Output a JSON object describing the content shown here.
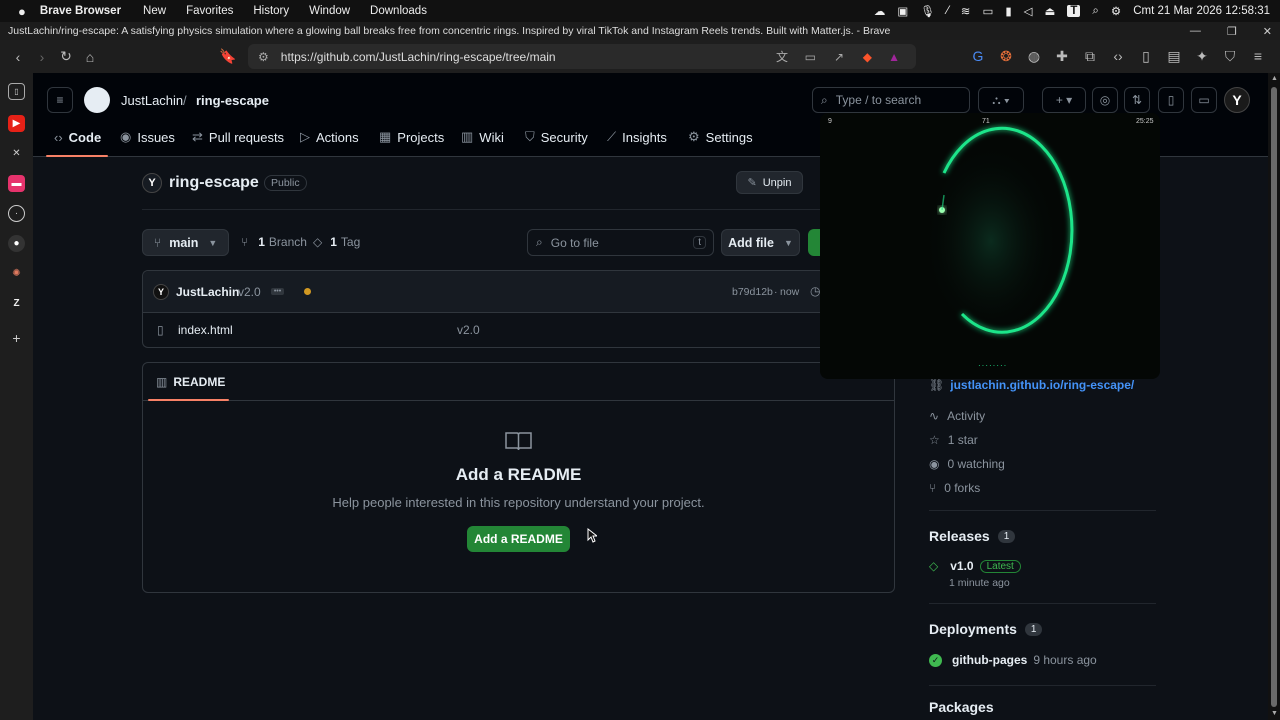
{
  "menubar": {
    "app_name": "Brave Browser",
    "items": [
      "New",
      "Favorites",
      "History",
      "Window",
      "Downloads"
    ],
    "datetime": "Cmt 21 Mar 2026 12:58:31",
    "status_t": "T"
  },
  "window": {
    "title": "JustLachin/ring-escape: A satisfying physics simulation where a glowing ball breaks free from concentric rings. Inspired by viral TikTok and Instagram Reels trends. Built with Matter.js. - Brave"
  },
  "browser": {
    "url": "https://github.com/JustLachin/ring-escape/tree/main"
  },
  "github": {
    "owner": "JustLachin",
    "separator": "/",
    "repo": "ring-escape",
    "search_placeholder": "Type / to search",
    "tabs": [
      {
        "label": "Code",
        "icon": "code-icon"
      },
      {
        "label": "Issues",
        "icon": "issue-icon"
      },
      {
        "label": "Pull requests",
        "icon": "pull-request-icon"
      },
      {
        "label": "Actions",
        "icon": "actions-icon"
      },
      {
        "label": "Projects",
        "icon": "projects-icon"
      },
      {
        "label": "Wiki",
        "icon": "book-icon"
      },
      {
        "label": "Security",
        "icon": "shield-icon"
      },
      {
        "label": "Insights",
        "icon": "graph-icon"
      },
      {
        "label": "Settings",
        "icon": "gear-icon"
      }
    ],
    "repo_title": "ring-escape",
    "visibility": "Public",
    "unpin_label": "Unpin",
    "branch": "main",
    "branch_count": "1",
    "branch_label": "Branch",
    "tag_count": "1",
    "tag_label": "Tag",
    "goto_file_placeholder": "Go to file",
    "goto_key": "t",
    "add_file_label": "Add file",
    "commit": {
      "author": "JustLachin",
      "message": "v2.0",
      "hash": "b79d12b",
      "separator": "·",
      "time": "now"
    },
    "files": [
      {
        "name": "index.html",
        "message": "v2.0"
      }
    ],
    "readme_tab": "README",
    "readme_empty_title": "Add a README",
    "readme_empty_desc": "Help people interested in this repository understand your project.",
    "add_readme_button": "Add a README",
    "about": {
      "website": "justlachin.github.io/ring-escape/",
      "activity": "Activity",
      "stars": "1 star",
      "watching": "0 watching",
      "forks": "0 forks"
    },
    "releases": {
      "title": "Releases",
      "count": "1",
      "version": "v1.0",
      "badge": "Latest",
      "time": "1 minute ago"
    },
    "deployments": {
      "title": "Deployments",
      "count": "1",
      "name": "github-pages",
      "time": "9 hours ago"
    },
    "packages_title": "Packages"
  },
  "overlay": {
    "left_counter": "9",
    "center_label": "71",
    "right_counter": "25:25"
  },
  "colors": {
    "accent_green": "#238636",
    "ring_glow": "#1fe58a",
    "link_blue": "#4493f8",
    "tab_underline": "#f78166"
  }
}
